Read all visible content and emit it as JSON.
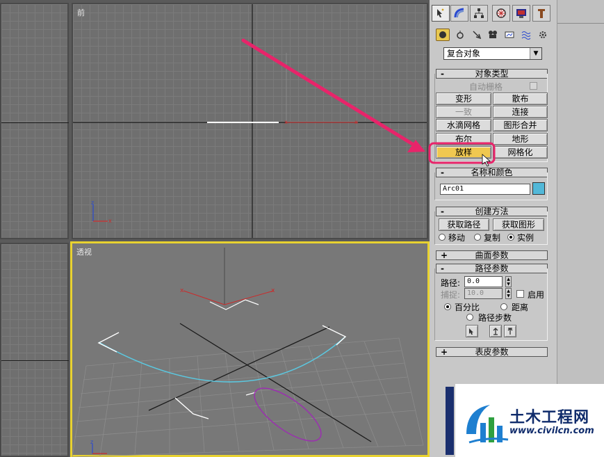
{
  "viewports": {
    "front_label": "前",
    "perspective_label": "透视"
  },
  "panel": {
    "tabs": [
      "create-icon",
      "modify-icon",
      "hierarchy-icon",
      "motion-icon",
      "display-icon",
      "utilities-icon"
    ],
    "subtabs": [
      "geometry-icon",
      "shapes-icon",
      "lights-icon",
      "cameras-icon",
      "helpers-icon",
      "spacewarps-icon",
      "systems-icon"
    ],
    "category_dropdown": "复合对象",
    "object_type": {
      "title": "对象类型",
      "autogrid_label": "自动栅格",
      "buttons": [
        "变形",
        "散布",
        "一致",
        "连接",
        "水滴网格",
        "图形合并",
        "布尔",
        "地形",
        "放样",
        "网格化"
      ]
    },
    "name_color": {
      "title": "名称和颜色",
      "name_value": "Arc01",
      "color": "#52b8d8"
    },
    "creation_method": {
      "title": "创建方法",
      "get_path": "获取路径",
      "get_shape": "获取图形",
      "move": "移动",
      "copy": "复制",
      "instance": "实例"
    },
    "surface_params": {
      "title": "曲面参数"
    },
    "path_params": {
      "title": "路径参数",
      "path_label": "路径:",
      "path_value": "0.0",
      "snap_label": "捕捉:",
      "snap_value": "10.0",
      "enable_label": "启用",
      "percent_label": "百分比",
      "distance_label": "距离",
      "path_steps_label": "路径步数"
    },
    "skin_params": {
      "title": "表皮参数"
    }
  },
  "watermark": {
    "title": "土木工程网",
    "url": "www.civilcn.com"
  },
  "colors": {
    "highlight_arrow": "#e8246a",
    "active_button": "#f0c850",
    "active_viewport_border": "#e8d230",
    "arc_cyan": "#5bc8e0",
    "ellipse_purple": "#9b2fb0"
  }
}
